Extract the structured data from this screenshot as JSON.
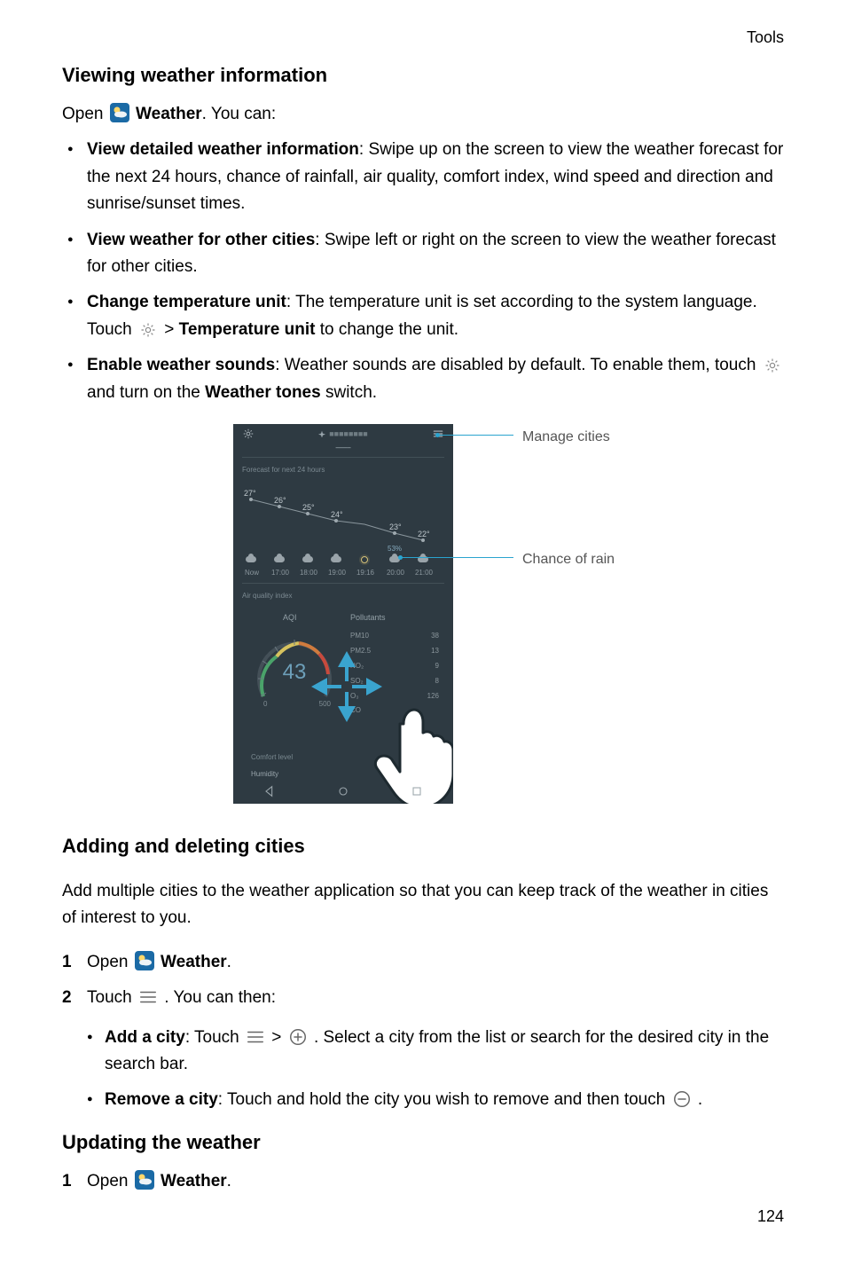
{
  "header": {
    "category": "Tools"
  },
  "page_number": "124",
  "s1": {
    "heading": "Viewing weather information",
    "intro_open": "Open ",
    "intro_app": "Weather",
    "intro_tail": ". You can:",
    "b1_strong": "View detailed weather information",
    "b1_rest": ": Swipe up on the screen to view the weather forecast for the next 24 hours, chance of rainfall, air quality, comfort index, wind speed and direction and sunrise/sunset times.",
    "b2_strong": "View weather for other cities",
    "b2_rest": ": Swipe left or right on the screen to view the weather forecast for other cities.",
    "b3_strong": "Change temperature unit",
    "b3_p1": ": The temperature unit is set according to the system language. Touch ",
    "b3_p2": " > ",
    "b3_temp_unit": "Temperature unit",
    "b3_p3": " to change the unit.",
    "b4_strong": "Enable weather sounds",
    "b4_p1": ": Weather sounds are disabled by default. To enable them, touch ",
    "b4_p2": " and turn on the ",
    "b4_tones": "Weather tones",
    "b4_p3": " switch."
  },
  "figure": {
    "callouts": {
      "manage_cities": "Manage cities",
      "chance_of_rain": "Chance of rain"
    },
    "phone": {
      "forecast_label": "Forecast for next 24 hours",
      "hours": [
        {
          "time": "Now",
          "temp": "27°"
        },
        {
          "time": "17:00",
          "temp": "26°"
        },
        {
          "time": "18:00",
          "temp": "25°"
        },
        {
          "time": "19:00",
          "temp": "24°"
        },
        {
          "time": "19:16",
          "temp": ""
        },
        {
          "time": "20:00",
          "temp": "23°"
        },
        {
          "time": "21:00",
          "temp": "22°"
        }
      ],
      "rain_pct": "53%",
      "aq_label": "Air quality index",
      "aqi_title": "AQI",
      "aqi_value": "43",
      "aqi_min": "0",
      "aqi_max": "500",
      "pollutants_title": "Pollutants",
      "pollutants": [
        {
          "name": "PM10",
          "value": "38"
        },
        {
          "name": "PM2.5",
          "value": "13"
        },
        {
          "name": "NO₂",
          "value": "9"
        },
        {
          "name": "SO₂",
          "value": "8"
        },
        {
          "name": "O₃",
          "value": "126"
        },
        {
          "name": "CO",
          "value": ""
        }
      ],
      "comfort_label": "Comfort level",
      "comfort_item": "Humidity"
    }
  },
  "s2": {
    "heading": "Adding and deleting cities",
    "intro": "Add multiple cities to the weather application so that you can keep track of the weather in cities of interest to you.",
    "step1_open": "Open ",
    "step1_app": "Weather",
    "step1_tail": ".",
    "step2_p1": "Touch ",
    "step2_p2": " . You can then:",
    "sub1_strong": "Add a city",
    "sub1_p1": ": Touch ",
    "sub1_gt": " > ",
    "sub1_p2": " . Select a city from the list or search for the desired city in the search bar.",
    "sub2_strong": "Remove a city",
    "sub2_p1": ": Touch and hold the city you wish to remove and then touch ",
    "sub2_p2": " ."
  },
  "s3": {
    "heading": "Updating the weather",
    "step1_open": "Open ",
    "step1_app": "Weather",
    "step1_tail": "."
  }
}
